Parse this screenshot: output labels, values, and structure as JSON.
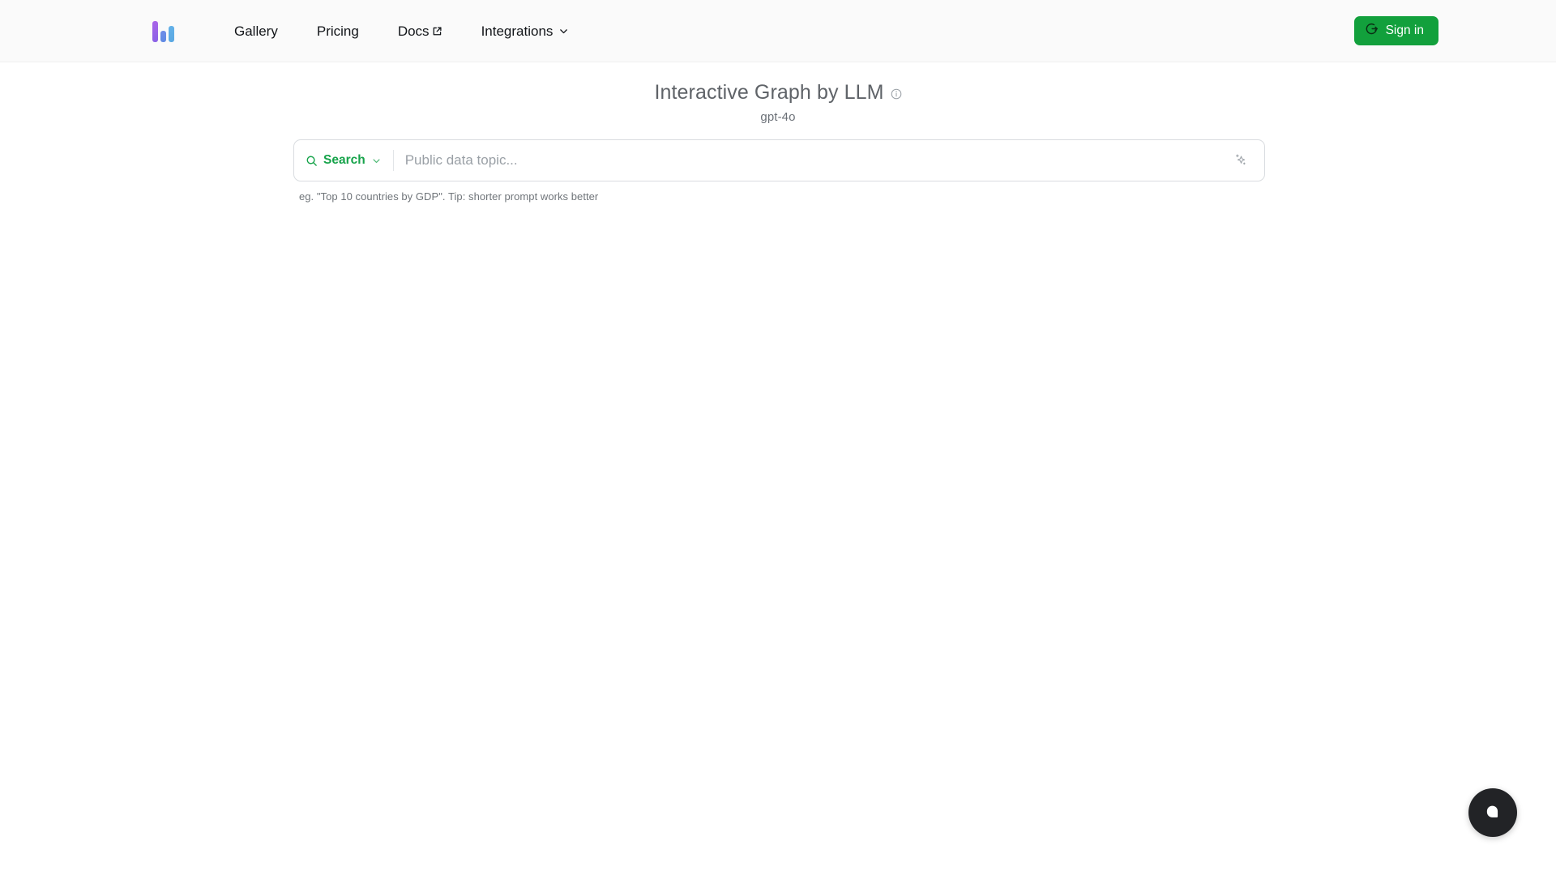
{
  "header": {
    "logo_name": "bar-chart-logo",
    "nav": [
      {
        "label": "Gallery",
        "icon": null
      },
      {
        "label": "Pricing",
        "icon": null
      },
      {
        "label": "Docs",
        "icon": "external-link-icon"
      },
      {
        "label": "Integrations",
        "icon": "chevron-down-icon"
      }
    ],
    "signin": {
      "label": "Sign in",
      "icon": "sign-in-icon",
      "color": "#12a03c"
    }
  },
  "main": {
    "title": "Interactive Graph by LLM",
    "title_info_icon": "info-icon",
    "subtitle": "gpt-4o",
    "search": {
      "type_label": "Search",
      "type_icon": "search-icon",
      "type_chevron": "chevron-down-icon",
      "value": "",
      "placeholder": "Public data topic...",
      "action_icon": "sparkles-icon",
      "accent_color": "#16a34a"
    },
    "hint": "eg. \"Top 10 countries by GDP\". Tip: shorter prompt works better"
  },
  "widgets": {
    "chat_fab": {
      "name": "chat-bubble-button",
      "icon": "chat-bubble-icon",
      "color": "#222326"
    }
  }
}
